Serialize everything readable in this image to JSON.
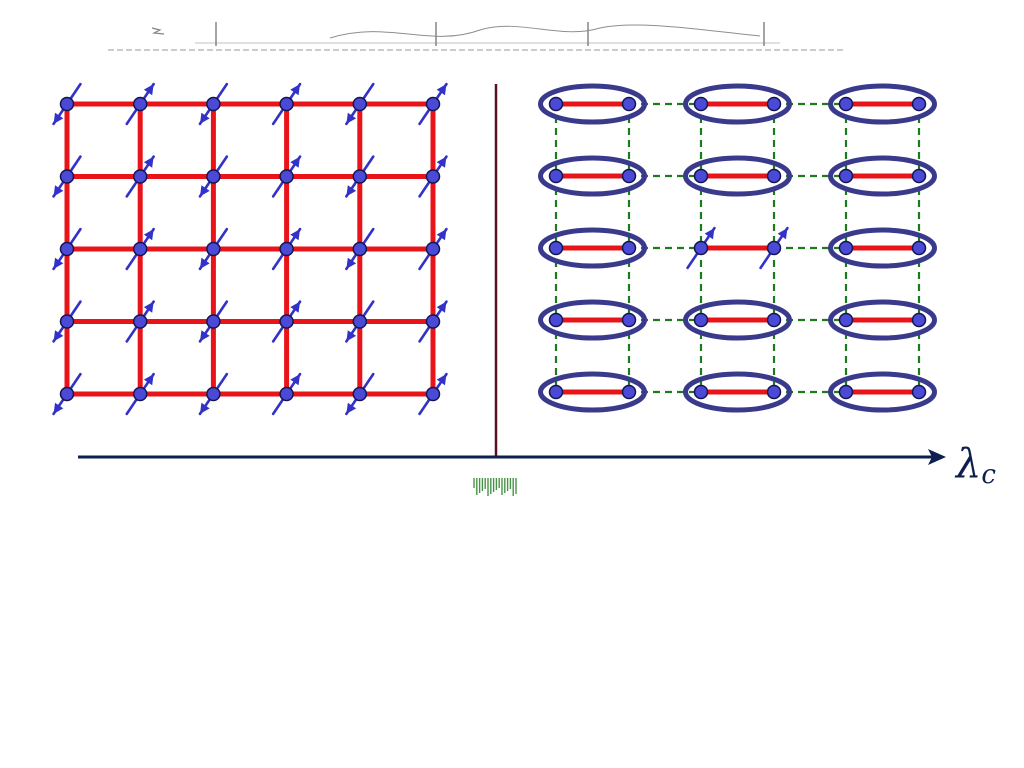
{
  "diagram": {
    "axis_label": "λ",
    "axis_label_subscript": "c",
    "colors": {
      "bond_strong": "#e8141a",
      "bond_weak": "#1f7a1f",
      "site_fill": "#4a4ad6",
      "site_stroke": "#141450",
      "spin_arrow": "#3232c8",
      "dimer_ring": "#3a3a8c",
      "divider": "#5a1020",
      "axis": "#0c1f4e",
      "caption_marks": "#1a7a1a"
    },
    "left_panel": {
      "lattice_columns": 6,
      "lattice_rows": 5,
      "bonds": "strong-all",
      "spin_orientation_per_row": [
        [
          "down-left",
          "up-right",
          "down-left",
          "up-right",
          "down-left",
          "up-right"
        ],
        [
          "down-left",
          "up-right",
          "down-left",
          "up-right",
          "down-left",
          "up-right"
        ],
        [
          "down-left",
          "up-right",
          "down-left",
          "up-right",
          "down-left",
          "up-right"
        ],
        [
          "down-left",
          "up-right",
          "down-left",
          "up-right",
          "down-left",
          "up-right"
        ],
        [
          "down-left",
          "up-right",
          "down-left",
          "up-right",
          "down-left",
          "up-right"
        ]
      ]
    },
    "right_panel": {
      "dimer_columns": 3,
      "dimer_rows": 5,
      "intra_dimer_bond": "strong",
      "inter_dimer_bond": "weak-dashed",
      "broken_dimer": {
        "row": 3,
        "column": 2,
        "spin_orientation": [
          "up-right",
          "up-right"
        ]
      }
    }
  }
}
